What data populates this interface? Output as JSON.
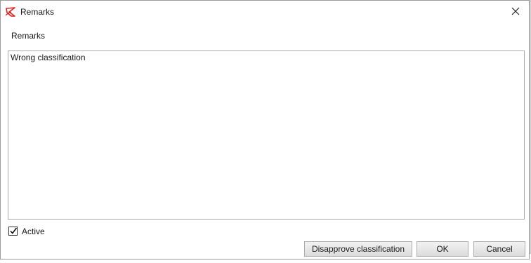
{
  "window": {
    "title": "Remarks",
    "icon": "app-logo-icon",
    "close_icon": "close-icon"
  },
  "form": {
    "section_label": "Remarks",
    "remarks_value": "Wrong classification",
    "active_label": "Active",
    "active_checked": true
  },
  "buttons": {
    "disapprove": "Disapprove classification",
    "ok": "OK",
    "cancel": "Cancel"
  },
  "colors": {
    "logo_red": "#d9231c",
    "border": "#a8a8a8",
    "button_border": "#acacac"
  }
}
